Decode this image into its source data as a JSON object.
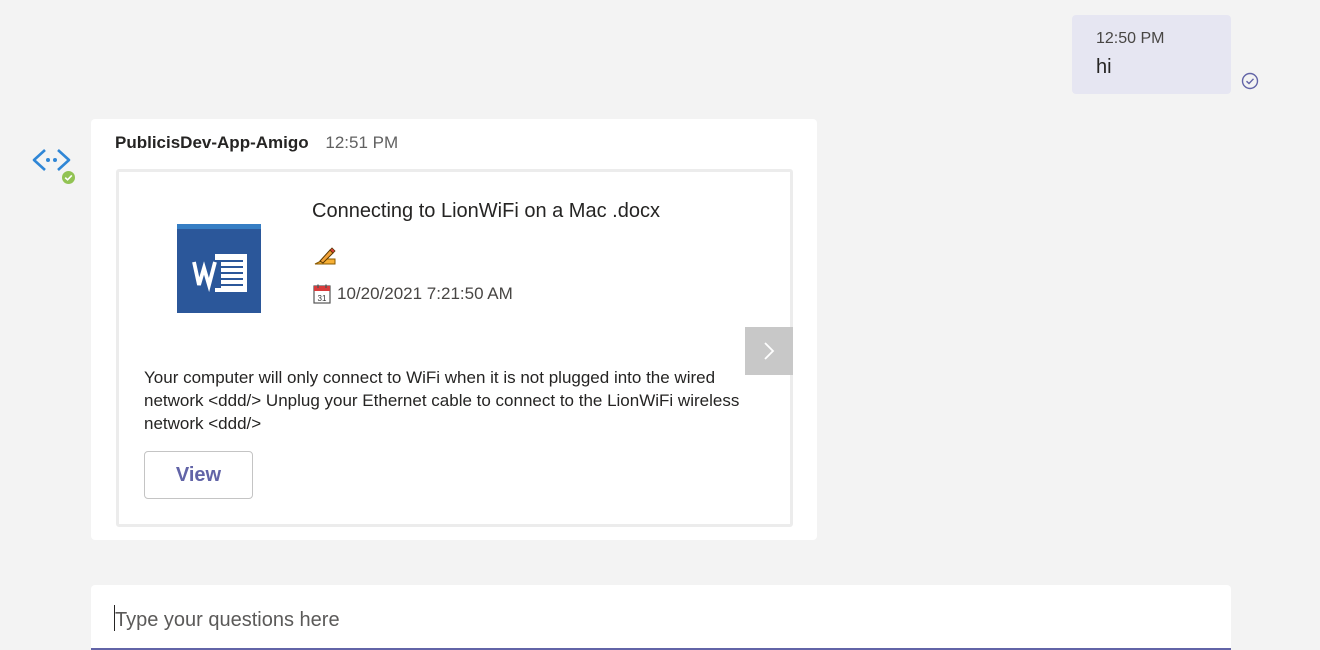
{
  "user_message": {
    "time": "12:50 PM",
    "text": "hi"
  },
  "bot_message": {
    "sender": "PublicisDev-App-Amigo",
    "time": "12:51 PM",
    "card": {
      "file_icon": "word-doc-icon",
      "title": "Connecting to LionWiFi on a Mac .docx",
      "author_icon": "pencil-icon",
      "date_icon": "calendar-icon",
      "date": "10/20/2021 7:21:50 AM",
      "body": "Your computer will only connect to WiFi when it is not plugged into the wired network <ddd/> Unplug your Ethernet cable to connect to the LionWiFi wireless network <ddd/>",
      "view_label": "View",
      "next_icon": "chevron-right-icon"
    }
  },
  "composer": {
    "placeholder": "Type your questions here",
    "value": ""
  },
  "colors": {
    "background": "#f3f3f3",
    "my_bubble": "#e6e6f2",
    "accent": "#6264a7",
    "status_available": "#92c353",
    "word_blue": "#2b579a"
  }
}
